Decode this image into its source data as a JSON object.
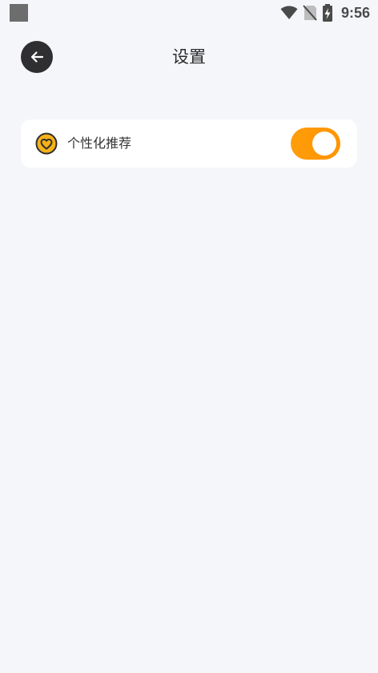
{
  "status_bar": {
    "time": "9:56",
    "icons": [
      "app-notification-icon",
      "wifi-icon",
      "no-sim-icon",
      "battery-charging-icon"
    ]
  },
  "header": {
    "title": "设置",
    "back_icon": "arrow-left-icon"
  },
  "settings": {
    "items": [
      {
        "label": "个性化推荐",
        "icon": "heart-badge-icon",
        "enabled": true
      }
    ]
  },
  "colors": {
    "background": "#f5f6fa",
    "accent": "#ff9800",
    "icon_fill": "#f6b21a",
    "back_button": "#2f2f31"
  }
}
